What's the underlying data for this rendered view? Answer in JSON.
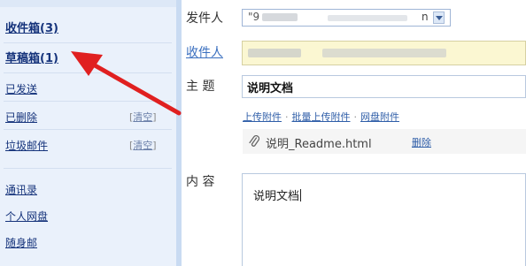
{
  "sidebar": {
    "folders": [
      {
        "label": "收件箱(3)"
      },
      {
        "label": "草稿箱(1)"
      },
      {
        "label": "已发送"
      },
      {
        "label": "已删除",
        "clear": "清空"
      },
      {
        "label": "垃圾邮件",
        "clear": "清空"
      },
      {
        "label": "通讯录"
      },
      {
        "label": "个人网盘"
      },
      {
        "label": "随身邮"
      }
    ]
  },
  "compose": {
    "from_label": "发件人",
    "from_value_visible_start": "\"9",
    "from_value_visible_end": "n",
    "to_label": "收件人",
    "subject_label": "主  题",
    "subject_value": "说明文档",
    "attach_links": [
      "上传附件",
      "批量上传附件",
      "网盘附件"
    ],
    "attachment": {
      "filename": "说明_Readme.html",
      "delete_label": "删除"
    },
    "content_label": "内  容",
    "content_value": "说明文档"
  },
  "colors": {
    "sidebar_bg": "#eaf1fb",
    "link": "#15337b",
    "recipient_bg": "#fbf7d2",
    "annotation_arrow": "#e02020"
  },
  "icons": [
    "paperclip-icon",
    "chevron-down-icon",
    "red-arrow-annotation"
  ]
}
